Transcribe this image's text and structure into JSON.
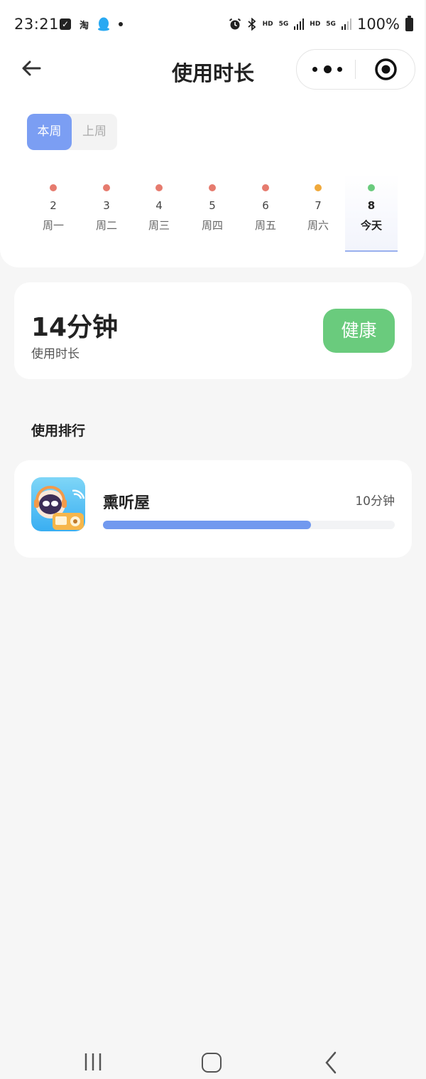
{
  "status_bar": {
    "time": "23:21",
    "taobao": "淘",
    "hd1": "HD",
    "sig1": "5G",
    "hd2": "HD",
    "sig2": "5G",
    "battery": "100%"
  },
  "header": {
    "title": "使用时长"
  },
  "week_toggle": {
    "current": "本周",
    "last": "上周",
    "selected": "本周"
  },
  "days": [
    {
      "num": "2",
      "label": "周一",
      "status_color": "#e67b6e"
    },
    {
      "num": "3",
      "label": "周二",
      "status_color": "#e67b6e"
    },
    {
      "num": "4",
      "label": "周三",
      "status_color": "#e67b6e"
    },
    {
      "num": "5",
      "label": "周四",
      "status_color": "#e67b6e"
    },
    {
      "num": "6",
      "label": "周五",
      "status_color": "#e67b6e"
    },
    {
      "num": "7",
      "label": "周六",
      "status_color": "#f0a93b"
    },
    {
      "num": "8",
      "label": "今天",
      "status_color": "#6acb7d",
      "selected": true
    }
  ],
  "summary": {
    "total": "14分钟",
    "label": "使用时长",
    "status": "健康"
  },
  "ranking": {
    "title": "使用排行",
    "apps": [
      {
        "name": "熏听屋",
        "time": "10分钟",
        "usage_fraction": 0.714
      }
    ]
  },
  "colors": {
    "accent": "#7b9ef3",
    "health": "#6acb7d",
    "bar": "#7199ef"
  }
}
